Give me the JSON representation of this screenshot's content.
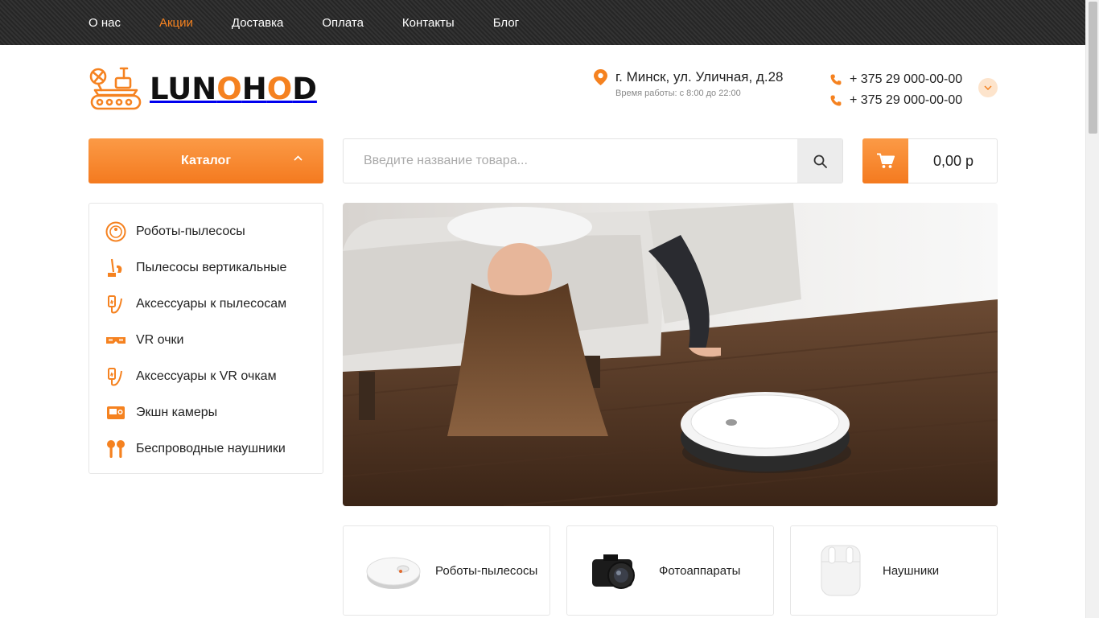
{
  "top_nav": {
    "items": [
      {
        "label": "О нас",
        "active": false
      },
      {
        "label": "Акции",
        "active": true
      },
      {
        "label": "Доставка",
        "active": false
      },
      {
        "label": "Оплата",
        "active": false
      },
      {
        "label": "Контакты",
        "active": false
      },
      {
        "label": "Блог",
        "active": false
      }
    ]
  },
  "brand": {
    "name_part1": "LUN",
    "name_o1": "O",
    "name_part2": "H",
    "name_o2": "O",
    "name_part3": "D",
    "icon": "lunar-rover-logo"
  },
  "header": {
    "address": "г. Минск, ул. Уличная, д.28",
    "hours": "Время работы: с 8:00 до 22:00",
    "phones": [
      "+ 375 29 000-00-00",
      "+ 375 29 000-00-00"
    ]
  },
  "catalog_button": {
    "label": "Каталог"
  },
  "search": {
    "placeholder": "Введите название товара...",
    "value": ""
  },
  "cart": {
    "total": "0,00 р"
  },
  "categories": [
    {
      "label": "Роботы-пылесосы",
      "icon": "robot-vacuum-icon"
    },
    {
      "label": "Пылесосы вертикальные",
      "icon": "vertical-vacuum-icon"
    },
    {
      "label": "Аксессуары к пылесосам",
      "icon": "accessory-cable-icon"
    },
    {
      "label": "VR очки",
      "icon": "vr-glasses-icon"
    },
    {
      "label": "Аксессуары к VR очкам",
      "icon": "accessory-cable-icon"
    },
    {
      "label": "Экшн камеры",
      "icon": "action-camera-icon"
    },
    {
      "label": "Беспроводные наушники",
      "icon": "earbuds-icon"
    }
  ],
  "tiles": [
    {
      "label": "Роботы-пылесосы",
      "icon": "robot-vacuum-photo"
    },
    {
      "label": "Фотоаппараты",
      "icon": "dslr-camera-photo"
    },
    {
      "label": "Наушники",
      "icon": "earbuds-case-photo"
    }
  ],
  "colors": {
    "accent": "#f58220",
    "topbar": "#2a2a2a"
  }
}
